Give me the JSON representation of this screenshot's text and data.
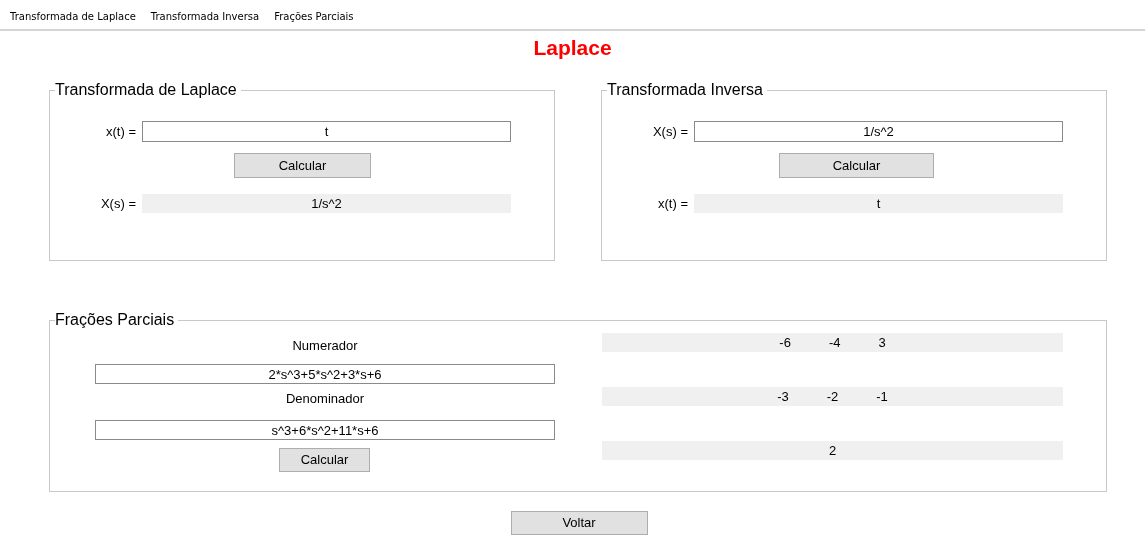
{
  "menu": [
    "Transformada de Laplace",
    "Transformada Inversa",
    "Frações Parciais"
  ],
  "title": "Laplace",
  "laplace": {
    "title": "Transformada de Laplace",
    "input_label": "x(t) =",
    "input_value": "t",
    "button": "Calcular",
    "output_label": "X(s) =",
    "output_value": "1/s^2"
  },
  "inverse": {
    "title": "Transformada Inversa",
    "input_label": "X(s) =",
    "input_value": "1/s^2",
    "button": "Calcular",
    "output_label": "x(t) =",
    "output_value": "t"
  },
  "partial": {
    "title": "Frações Parciais",
    "numerator_label": "Numerador",
    "numerator_value": "2*s^3+5*s^2+3*s+6",
    "denominator_label": "Denominador",
    "denominator_value": "s^3+6*s^2+11*s+6",
    "button": "Calcular",
    "results": [
      [
        "-6",
        "-4",
        "3"
      ],
      [
        "-3",
        "-2",
        "-1"
      ],
      [
        "2"
      ]
    ]
  },
  "back_button": "Voltar"
}
